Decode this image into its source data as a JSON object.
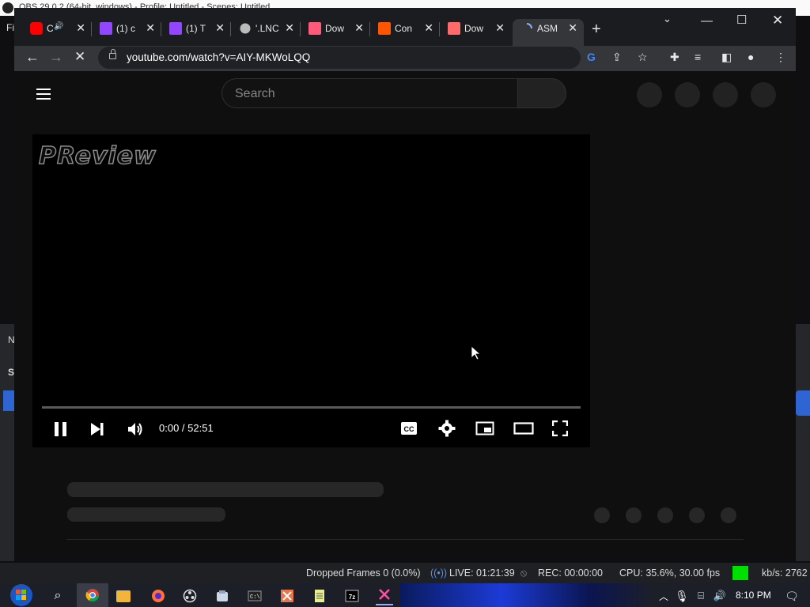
{
  "obs": {
    "title": "OBS 29.0.2 (64-bit, windows) - Profile: Untitled - Scenes: Untitled",
    "menu_first_letter": "Fi",
    "left_labels": [
      "N",
      "S"
    ],
    "status": {
      "dropped_frames": "Dropped Frames 0 (0.0%)",
      "live": "LIVE: 01:21:39",
      "rec": "REC: 00:00:00",
      "cpu": "CPU: 35.6%, 30.00 fps",
      "bitrate": "kb/s: 2762"
    }
  },
  "browser": {
    "tabs": [
      {
        "label": "C",
        "icon": "youtube-icon",
        "icon_color": "#ff0000",
        "audio": true
      },
      {
        "label": "(1) c",
        "icon": "twitch-icon",
        "icon_color": "#9146ff"
      },
      {
        "label": "(1) T",
        "icon": "twitch-icon",
        "icon_color": "#9146ff"
      },
      {
        "label": "'.LNC",
        "icon": "globe-icon",
        "icon_color": "#bbbbbb"
      },
      {
        "label": "Dow",
        "icon": "download-site-icon",
        "icon_color": "#ff5a7a"
      },
      {
        "label": "Con",
        "icon": "orange-square-icon",
        "icon_color": "#ff5500"
      },
      {
        "label": "Dow",
        "icon": "store-icon",
        "icon_color": "#ff6b6b"
      },
      {
        "label": "ASM",
        "icon": "loading-spinner-icon",
        "icon_color": "#8ab4f8",
        "active": true
      }
    ],
    "url": "youtube.com/watch?v=AIY-MKWoLQQ"
  },
  "youtube": {
    "search_placeholder": "Search",
    "player": {
      "watermark": "PReview",
      "time": "0:00 / 52:51",
      "progress_fraction": 0.0
    }
  },
  "taskbar": {
    "clock": "8:10 PM",
    "apps": [
      "start-icon",
      "search-icon",
      "chrome-icon",
      "file-explorer-icon",
      "firefox-icon",
      "obs-icon",
      "game-icon",
      "terminal-icon",
      "tool-icon",
      "notepad-icon",
      "7zip-icon",
      "app-icon"
    ]
  }
}
